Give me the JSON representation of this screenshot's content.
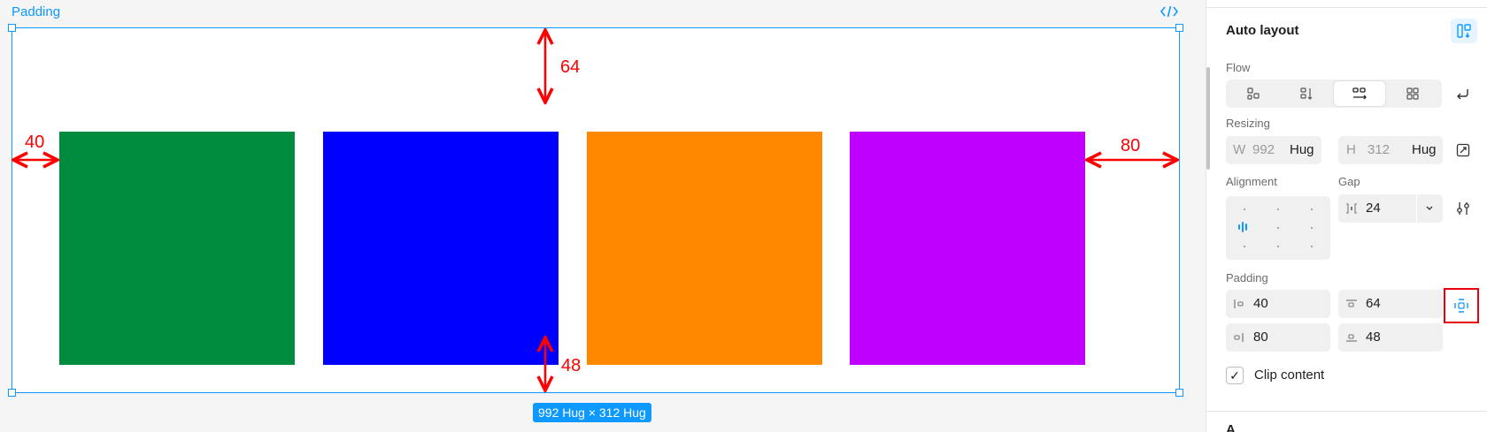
{
  "canvas": {
    "frame_name": "Padding",
    "size_label": "992 Hug × 312 Hug",
    "squares": [
      {
        "name": "green-square",
        "color": "#008c3e"
      },
      {
        "name": "blue-square",
        "color": "#0000ff"
      },
      {
        "name": "orange-square",
        "color": "#ff8800"
      },
      {
        "name": "purple-square",
        "color": "#c000ff"
      }
    ],
    "annotations": {
      "left": "40",
      "top": "64",
      "right": "80",
      "bottom": "48"
    },
    "annotation_color": "#ff0000",
    "selection_color": "#0d99ff"
  },
  "panel": {
    "title": "Auto layout",
    "flow": {
      "label": "Flow",
      "options": [
        {
          "icon": "flow-none-icon"
        },
        {
          "icon": "flow-vertical-icon"
        },
        {
          "icon": "flow-horizontal-icon",
          "active": true
        },
        {
          "icon": "flow-grid-icon"
        }
      ],
      "wrap_icon": "wrap-icon"
    },
    "resizing": {
      "label": "Resizing",
      "width": {
        "prefix": "W",
        "value": "992",
        "mode": "Hug"
      },
      "height": {
        "prefix": "H",
        "value": "312",
        "mode": "Hug"
      }
    },
    "alignment": {
      "label": "Alignment"
    },
    "gap": {
      "label": "Gap",
      "value": "24"
    },
    "padding": {
      "label": "Padding",
      "left": "40",
      "top": "64",
      "right": "80",
      "bottom": "48"
    },
    "clip_content": {
      "label": "Clip content",
      "checked": true,
      "check_glyph": "✓"
    },
    "next_section": "A"
  }
}
